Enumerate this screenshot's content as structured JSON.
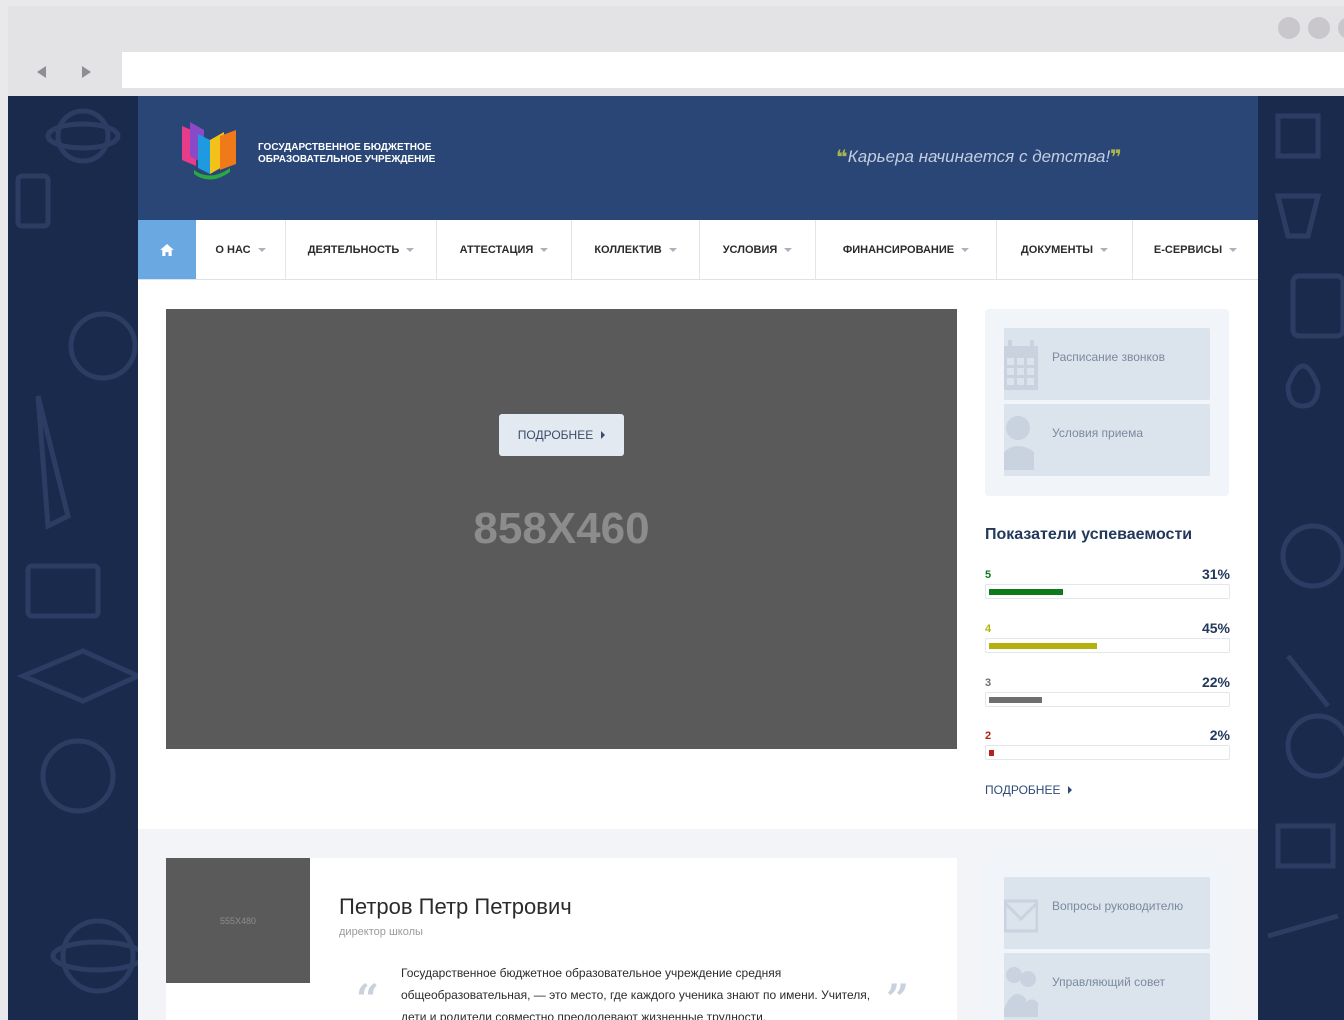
{
  "org": {
    "name_line1": "ГОСУДАРСТВЕННОЕ БЮДЖЕТНОЕ",
    "name_line2": "ОБРАЗОВАТЕЛЬНОЕ УЧРЕЖДЕНИЕ",
    "motto": "Карьера начинается с детства!",
    "quote_open": "❝",
    "quote_close": "❞"
  },
  "menu": [
    {
      "label": "О НАС"
    },
    {
      "label": "ДЕЯТЕЛЬНОСТЬ"
    },
    {
      "label": "АТТЕСТАЦИЯ"
    },
    {
      "label": "КОЛЛЕКТИВ"
    },
    {
      "label": "УСЛОВИЯ"
    },
    {
      "label": "ФИНАНСИРОВАНИЕ"
    },
    {
      "label": "ДОКУМЕНТЫ"
    },
    {
      "label": "Е-СЕРВИСЫ"
    }
  ],
  "slider": {
    "button_label": "ПОДРОБНЕЕ",
    "placeholder": "858X460"
  },
  "quick_links": [
    {
      "label": "Расписание звонков",
      "icon": "calendar-icon"
    },
    {
      "label": "Условия приема",
      "icon": "person-icon"
    }
  ],
  "stats": {
    "title": "Показатели успеваемости",
    "items": [
      {
        "grade": "5",
        "percent": "31%",
        "value": 31,
        "color": "#0e7a1f"
      },
      {
        "grade": "4",
        "percent": "45%",
        "value": 45,
        "color": "#b5b10f"
      },
      {
        "grade": "3",
        "percent": "22%",
        "value": 22,
        "color": "#6f6f6f"
      },
      {
        "grade": "2",
        "percent": "2%",
        "value": 2,
        "color": "#b3231b"
      }
    ],
    "more_label": "ПОДРОБНЕЕ"
  },
  "director": {
    "photo_placeholder": "555X480",
    "name": "Петров Петр Петрович",
    "role": "директор школы",
    "quote": "Государственное бюджетное образовательное учреждение средняя общеобразовательная, — это место, где каждого ученика знают по имени. Учителя, дети и родители совместно преодолевают жизненные трудности,"
  },
  "bottom_links": [
    {
      "label": "Вопросы руководителю",
      "icon": "envelope-icon"
    },
    {
      "label": "Управляющий совет",
      "icon": "group-icon"
    }
  ],
  "colors": {
    "header_bg": "#2a4676",
    "accent_home": "#6aa8e2",
    "page_bg": "#1a2a4c"
  }
}
